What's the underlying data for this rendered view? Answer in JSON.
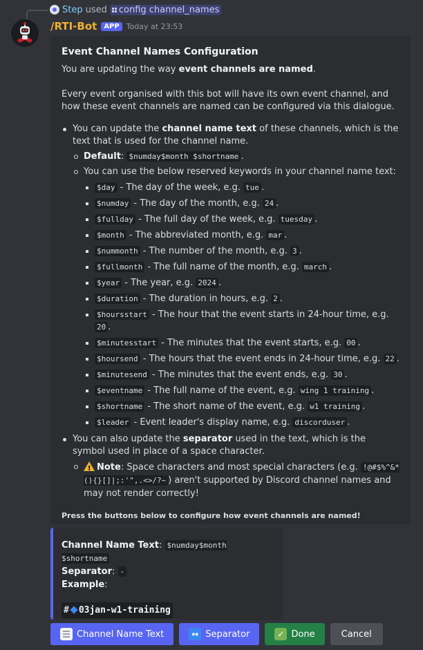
{
  "reply": {
    "label": "Step",
    "used_text": "used",
    "command": "config channel_names"
  },
  "message": {
    "username": "/RTI-Bot",
    "badge": "APP",
    "timestamp": "Today at 23:53"
  },
  "embed": {
    "title": "Event Channel Names Configuration",
    "intro_prefix": "You are updating the way ",
    "intro_bold": "event channels are named",
    "intro_suffix": ".",
    "description": "Every event organised with this bot will have its own event channel, and how these event channels are named can be configured via this dialogue.",
    "bullet1_prefix": "You can update the ",
    "bullet1_bold": "channel name text",
    "bullet1_suffix": " of these channels, which is the text that is used for the channel name.",
    "default_label": "Default",
    "default_value": "$numday$month $shortname",
    "keywords_intro": "You can use the below reserved keywords in your channel name text:",
    "keywords": [
      {
        "key": "$day",
        "desc": " - The day of the week, e.g. ",
        "example": "tue"
      },
      {
        "key": "$numday",
        "desc": " - The day of the month, e.g. ",
        "example": "24"
      },
      {
        "key": "$fullday",
        "desc": " - The full day of the week, e.g. ",
        "example": "tuesday"
      },
      {
        "key": "$month",
        "desc": " - The abbreviated month, e.g. ",
        "example": "mar"
      },
      {
        "key": "$nummonth",
        "desc": " - The number of the month, e.g. ",
        "example": "3"
      },
      {
        "key": "$fullmonth",
        "desc": " - The full name of the month, e.g. ",
        "example": "march"
      },
      {
        "key": "$year",
        "desc": " - The year, e.g. ",
        "example": "2024"
      },
      {
        "key": "$duration",
        "desc": " - The duration in hours, e.g. ",
        "example": "2"
      },
      {
        "key": "$hoursstart",
        "desc": " - The hour that the event starts in 24-hour time, e.g. ",
        "example": "20"
      },
      {
        "key": "$minutesstart",
        "desc": " - The minutes that the event starts, e.g. ",
        "example": "00"
      },
      {
        "key": "$hoursend",
        "desc": " - The hours that the event ends in 24-hour time, e.g. ",
        "example": "22"
      },
      {
        "key": "$minutesend",
        "desc": " - The minutes  that the event ends, e.g. ",
        "example": "30"
      },
      {
        "key": "$eventname",
        "desc": " - The full name of the event, e.g. ",
        "example": "wing 1 training"
      },
      {
        "key": "$shortname",
        "desc": " - The short name of the event, e.g. ",
        "example": "w1 training"
      },
      {
        "key": "$leader",
        "desc": " - Event leader's display name, e.g. ",
        "example": "discorduser"
      }
    ],
    "bullet2_prefix": "You can also update the ",
    "bullet2_bold": "separator",
    "bullet2_suffix": " used in the text, which is the symbol used in place of a space character.",
    "note_label": "Note",
    "note_prefix": ": Space characters and most special characters (e.g. ",
    "note_code": "!@#$%^&*(){}[]|;:'\",.<>/?~",
    "note_suffix": ") aren't supported by Discord channel names and may not render correctly!",
    "footer": "Press the buttons below to configure how event channels are named!"
  },
  "summary": {
    "channel_label": "Channel Name Text",
    "channel_value": "$numday$month $shortname",
    "separator_label": "Separator",
    "separator_value": "-",
    "example_label": "Example",
    "example_hash": "#",
    "example_channel": "03jan-w1-training"
  },
  "buttons": {
    "channel_name_text": "Channel Name Text",
    "separator": "Separator",
    "done": "Done",
    "cancel": "Cancel"
  },
  "colors": {
    "background": "#313338",
    "embed_bg": "#2b2d31",
    "blurple": "#5865f2",
    "green": "#248046",
    "grey": "#4e5058",
    "username": "#f0b232"
  }
}
